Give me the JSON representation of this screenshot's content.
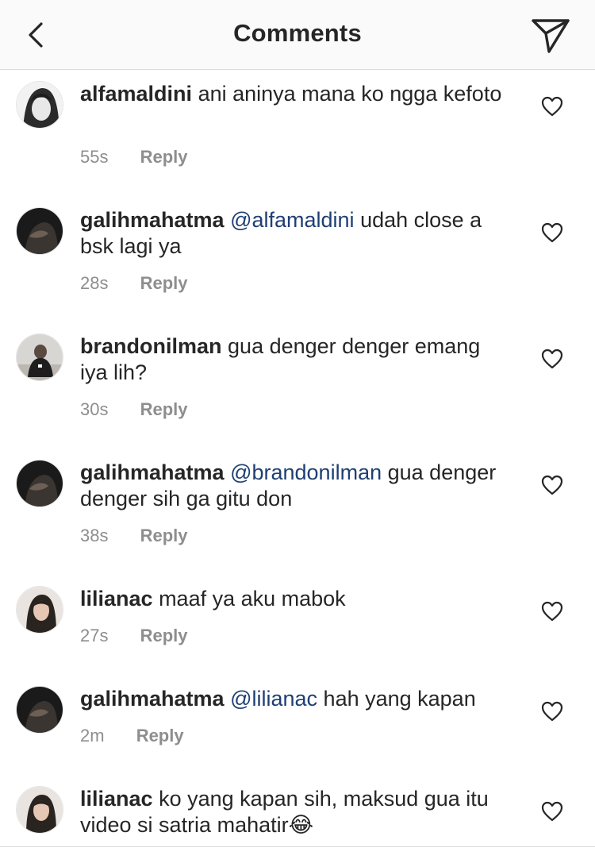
{
  "header": {
    "title": "Comments",
    "back_icon": "chevron-left-icon",
    "send_icon": "paper-plane-icon"
  },
  "reply_label": "Reply",
  "like_icon": "heart-outline-icon",
  "colors": {
    "text": "#262626",
    "mention": "#1f3f73",
    "meta": "#8e8e8e",
    "header_bg": "#fafafa"
  },
  "comments": [
    {
      "username": "alfamaldini",
      "mention": "",
      "text": "ani aninya mana ko ngga kefoto",
      "time": "55s"
    },
    {
      "username": "galihmahatma",
      "mention": "@alfamaldini",
      "text": "udah close a bsk lagi ya",
      "time": "28s"
    },
    {
      "username": "brandonilman",
      "mention": "",
      "text": "gua denger denger emang iya lih?",
      "time": "30s"
    },
    {
      "username": "galihmahatma",
      "mention": "@brandonilman",
      "text": "gua denger denger sih ga gitu don",
      "time": "38s"
    },
    {
      "username": "lilianac",
      "mention": "",
      "text": "maaf ya aku mabok",
      "time": "27s"
    },
    {
      "username": "galihmahatma",
      "mention": "@lilianac",
      "text": "hah yang kapan",
      "time": "2m"
    },
    {
      "username": "lilianac",
      "mention": "",
      "text": "ko yang kapan sih, maksud gua itu video si satria mahatir😂",
      "time": ""
    }
  ]
}
